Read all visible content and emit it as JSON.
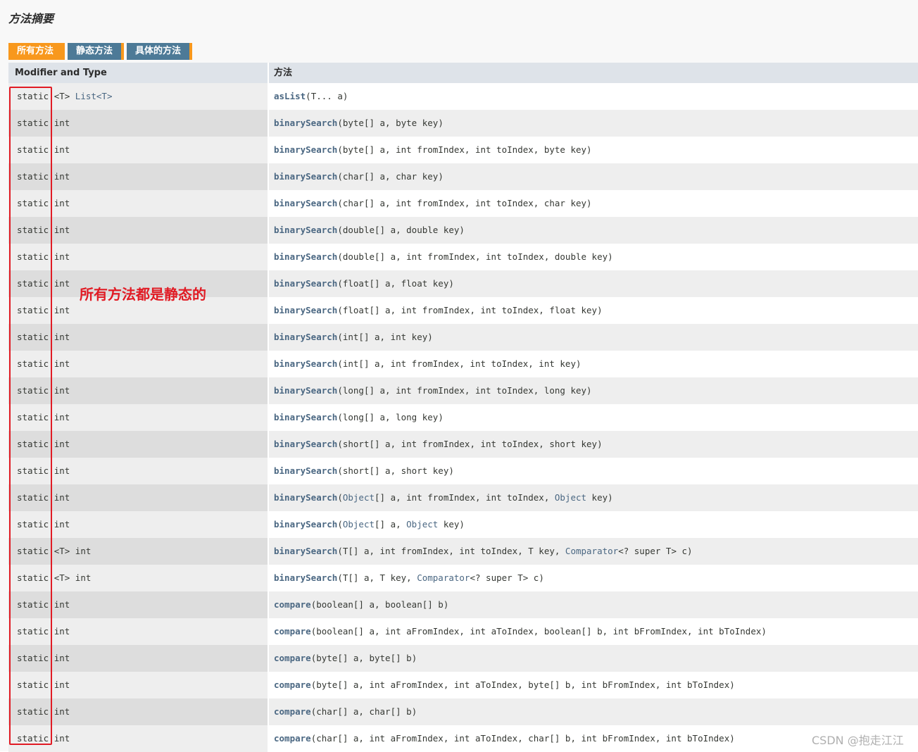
{
  "section_title": "方法摘要",
  "tabs": [
    {
      "label": "所有方法",
      "active": true
    },
    {
      "label": "静态方法",
      "active": false
    },
    {
      "label": "具体的方法",
      "active": false
    }
  ],
  "table": {
    "headers": [
      "Modifier and Type",
      "方法"
    ],
    "rows": [
      {
        "modifier": "static",
        "generic": "<T>",
        "type": "List<T>",
        "type_link": true,
        "method": "asList",
        "params": [
          {
            "t": "T... a"
          }
        ]
      },
      {
        "modifier": "static",
        "generic": "",
        "type": "int",
        "method": "binarySearch",
        "params": [
          {
            "t": "byte[] a, byte key"
          }
        ]
      },
      {
        "modifier": "static",
        "generic": "",
        "type": "int",
        "method": "binarySearch",
        "params": [
          {
            "t": "byte[] a, int fromIndex, int toIndex, byte key"
          }
        ]
      },
      {
        "modifier": "static",
        "generic": "",
        "type": "int",
        "method": "binarySearch",
        "params": [
          {
            "t": "char[] a, char key"
          }
        ]
      },
      {
        "modifier": "static",
        "generic": "",
        "type": "int",
        "method": "binarySearch",
        "params": [
          {
            "t": "char[] a, int fromIndex, int toIndex, char key"
          }
        ]
      },
      {
        "modifier": "static",
        "generic": "",
        "type": "int",
        "method": "binarySearch",
        "params": [
          {
            "t": "double[] a, double key"
          }
        ]
      },
      {
        "modifier": "static",
        "generic": "",
        "type": "int",
        "method": "binarySearch",
        "params": [
          {
            "t": "double[] a, int fromIndex, int toIndex, double key"
          }
        ]
      },
      {
        "modifier": "static",
        "generic": "",
        "type": "int",
        "method": "binarySearch",
        "params": [
          {
            "t": "float[] a, float key"
          }
        ]
      },
      {
        "modifier": "static",
        "generic": "",
        "type": "int",
        "method": "binarySearch",
        "params": [
          {
            "t": "float[] a, int fromIndex, int toIndex, float key"
          }
        ]
      },
      {
        "modifier": "static",
        "generic": "",
        "type": "int",
        "method": "binarySearch",
        "params": [
          {
            "t": "int[] a, int key"
          }
        ]
      },
      {
        "modifier": "static",
        "generic": "",
        "type": "int",
        "method": "binarySearch",
        "params": [
          {
            "t": "int[] a, int fromIndex, int toIndex, int key"
          }
        ]
      },
      {
        "modifier": "static",
        "generic": "",
        "type": "int",
        "method": "binarySearch",
        "params": [
          {
            "t": "long[] a, int fromIndex, int toIndex, long key"
          }
        ]
      },
      {
        "modifier": "static",
        "generic": "",
        "type": "int",
        "method": "binarySearch",
        "params": [
          {
            "t": "long[] a, long key"
          }
        ]
      },
      {
        "modifier": "static",
        "generic": "",
        "type": "int",
        "method": "binarySearch",
        "params": [
          {
            "t": "short[] a, int fromIndex, int toIndex, short key"
          }
        ]
      },
      {
        "modifier": "static",
        "generic": "",
        "type": "int",
        "method": "binarySearch",
        "params": [
          {
            "t": "short[] a, short key"
          }
        ]
      },
      {
        "modifier": "static",
        "generic": "",
        "type": "int",
        "method": "binarySearch",
        "params": [
          {
            "t": "Object",
            "link": true
          },
          {
            "t": "[] a, int fromIndex, int toIndex, "
          },
          {
            "t": "Object",
            "link": true
          },
          {
            "t": " key"
          }
        ]
      },
      {
        "modifier": "static",
        "generic": "",
        "type": "int",
        "method": "binarySearch",
        "params": [
          {
            "t": "Object",
            "link": true
          },
          {
            "t": "[] a, "
          },
          {
            "t": "Object",
            "link": true
          },
          {
            "t": " key"
          }
        ]
      },
      {
        "modifier": "static",
        "generic": "<T>",
        "type": "int",
        "method": "binarySearch",
        "params": [
          {
            "t": "T[] a, int fromIndex, int toIndex, T key, "
          },
          {
            "t": "Comparator",
            "link": true
          },
          {
            "t": "<? super T> c"
          }
        ]
      },
      {
        "modifier": "static",
        "generic": "<T>",
        "type": "int",
        "method": "binarySearch",
        "params": [
          {
            "t": "T[] a, T key, "
          },
          {
            "t": "Comparator",
            "link": true
          },
          {
            "t": "<? super T> c"
          }
        ]
      },
      {
        "modifier": "static",
        "generic": "",
        "type": "int",
        "method": "compare",
        "params": [
          {
            "t": "boolean[] a, boolean[] b"
          }
        ]
      },
      {
        "modifier": "static",
        "generic": "",
        "type": "int",
        "method": "compare",
        "params": [
          {
            "t": "boolean[] a, int aFromIndex, int aToIndex, boolean[] b, int bFromIndex, int bToIndex"
          }
        ]
      },
      {
        "modifier": "static",
        "generic": "",
        "type": "int",
        "method": "compare",
        "params": [
          {
            "t": "byte[] a, byte[] b"
          }
        ]
      },
      {
        "modifier": "static",
        "generic": "",
        "type": "int",
        "method": "compare",
        "params": [
          {
            "t": "byte[] a, int aFromIndex, int aToIndex, byte[] b, int bFromIndex, int bToIndex"
          }
        ]
      },
      {
        "modifier": "static",
        "generic": "",
        "type": "int",
        "method": "compare",
        "params": [
          {
            "t": "char[] a, char[] b"
          }
        ]
      },
      {
        "modifier": "static",
        "generic": "",
        "type": "int",
        "method": "compare",
        "params": [
          {
            "t": "char[] a, int aFromIndex, int aToIndex, char[] b, int bFromIndex, int bToIndex"
          }
        ]
      }
    ]
  },
  "annotation": {
    "text": "所有方法都是静态的",
    "color": "#e11b24"
  },
  "watermark": "CSDN @抱走江江",
  "colors": {
    "tab_active": "#f8981d",
    "tab_inactive": "#4d7a97",
    "link": "#4a6782",
    "header_bg": "#dee3e9"
  }
}
